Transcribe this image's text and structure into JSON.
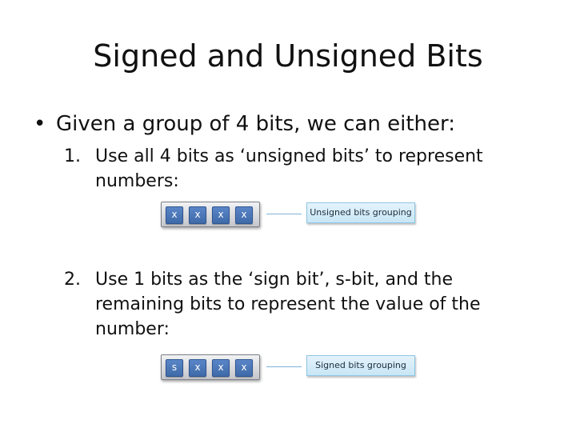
{
  "slide": {
    "title": "Signed and Unsigned Bits",
    "bullet": "Given a group of 4 bits, we can either:",
    "items": [
      {
        "number": "1.",
        "lines": [
          "Use all 4 bits as ‘unsigned bits’ to represent",
          "numbers:"
        ],
        "bits": [
          "x",
          "x",
          "x",
          "x"
        ],
        "callout": "Unsigned bits grouping"
      },
      {
        "number": "2.",
        "lines": [
          "Use 1 bits as the ‘sign bit’, s-bit, and the",
          "remaining bits to represent the value of the",
          "number:"
        ],
        "bits": [
          "s",
          "x",
          "x",
          "x"
        ],
        "callout": "Signed bits grouping"
      }
    ]
  }
}
